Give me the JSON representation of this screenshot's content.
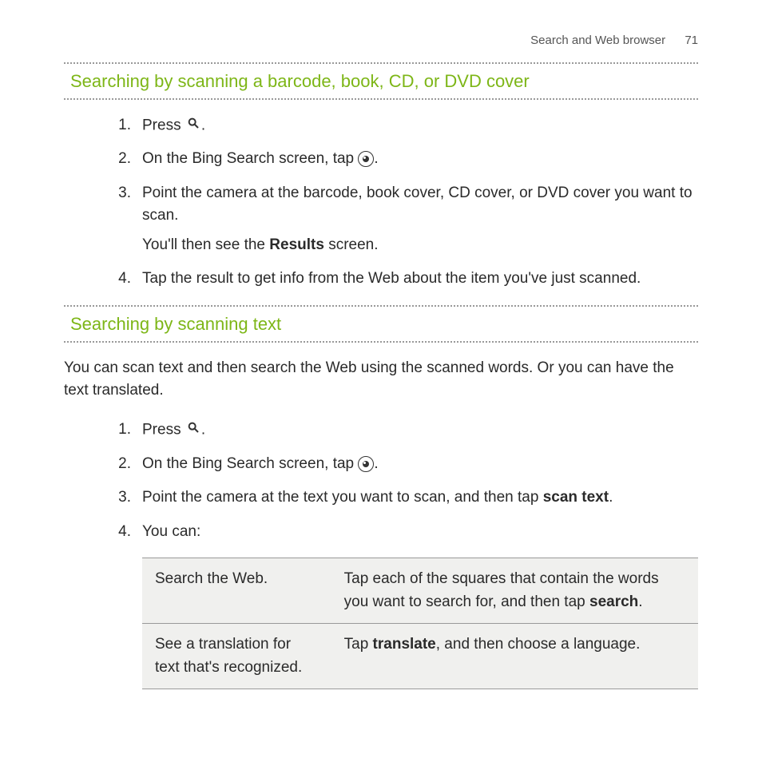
{
  "header": {
    "section_title": "Search and Web browser",
    "page_number": "71"
  },
  "section1": {
    "title": "Searching by scanning a barcode, book, CD, or DVD cover",
    "steps": {
      "n1": "1.",
      "s1a": "Press ",
      "s1b": ".",
      "n2": "2.",
      "s2a": "On the Bing Search screen, tap ",
      "s2b": ".",
      "n3": "3.",
      "s3a": "Point the camera at the barcode, book cover, CD cover, or DVD cover you want to scan.",
      "s3b_a": "You'll then see the ",
      "s3b_bold": "Results",
      "s3b_b": " screen.",
      "n4": "4.",
      "s4": "Tap the result to get info from the Web about the item you've just scanned."
    }
  },
  "section2": {
    "title": "Searching by scanning text",
    "intro": "You can scan text and then search the Web using the scanned words. Or you can have the text translated.",
    "steps": {
      "n1": "1.",
      "s1a": "Press ",
      "s1b": ".",
      "n2": "2.",
      "s2a": "On the Bing Search screen, tap ",
      "s2b": ".",
      "n3": "3.",
      "s3a": "Point the camera at the text you want to scan, and then tap ",
      "s3bold": "scan text",
      "s3b": ".",
      "n4": "4.",
      "s4": "You can:"
    },
    "table": {
      "r1c1": "Search the Web.",
      "r1c2a": "Tap each of the squares that contain the words you want to search for, and then tap ",
      "r1c2bold": "search",
      "r1c2b": ".",
      "r2c1": "See a translation for text that's recognized.",
      "r2c2a": "Tap ",
      "r2c2bold": "translate",
      "r2c2b": ", and then choose a language."
    }
  }
}
